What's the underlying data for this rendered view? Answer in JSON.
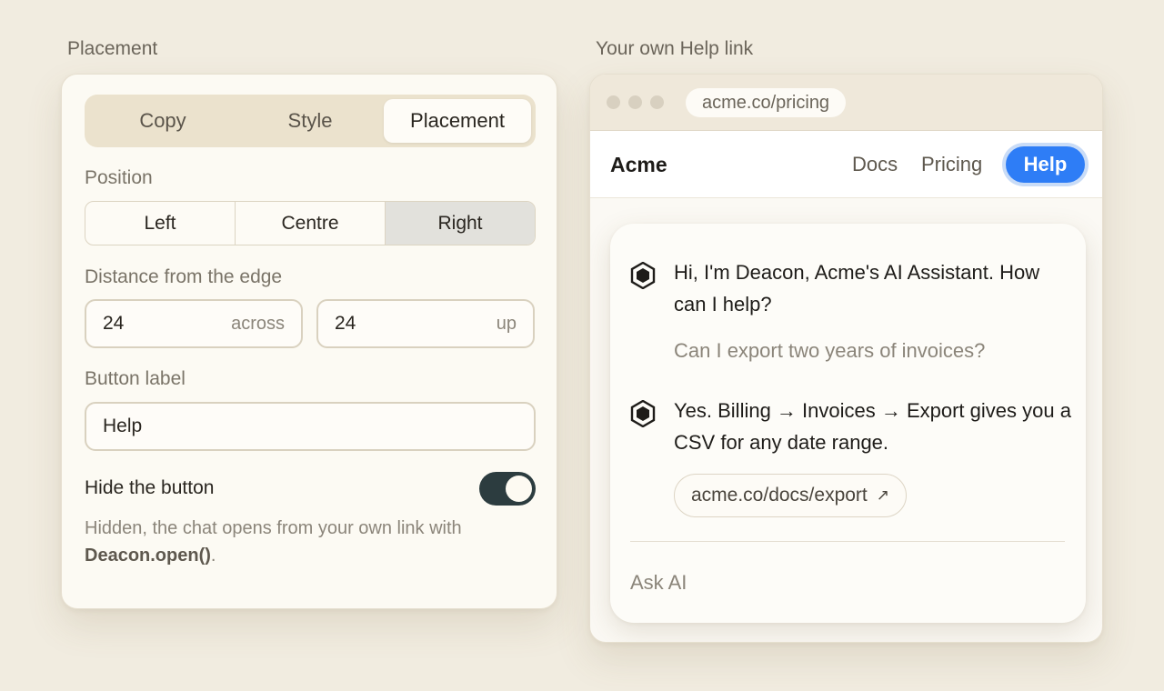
{
  "left_section_label": "Placement",
  "right_section_label": "Your own Help link",
  "settings": {
    "tabs": [
      "Copy",
      "Style",
      "Placement"
    ],
    "active_tab": "Placement",
    "position_label": "Position",
    "position_options": [
      "Left",
      "Centre",
      "Right"
    ],
    "position_selected": "Right",
    "distance_label": "Distance from the edge",
    "across_value": "24",
    "across_unit": "across",
    "up_value": "24",
    "up_unit": "up",
    "button_label_label": "Button label",
    "button_label_value": "Help",
    "hide_label": "Hide the button",
    "hide_on": true,
    "hint_text": "Hidden, the chat opens from your own link with",
    "hint_code": "Deacon.open()",
    "hint_end": "."
  },
  "browser": {
    "url": "acme.co/pricing",
    "brand": "Acme",
    "nav": [
      "Docs",
      "Pricing"
    ],
    "help_button": "Help",
    "accent": "#2e7df6"
  },
  "chat": {
    "assistant_greeting": "Hi, I'm Deacon, Acme's AI Assistant. How can I help?",
    "user_message": "Can I export two years of invoices?",
    "assistant_reply": "Yes. Billing → Invoices → Export gives you a CSV for any date range.",
    "link_text": "acme.co/docs/export",
    "link_icon": "arrow-up-right-icon",
    "input_placeholder": "Ask AI"
  }
}
